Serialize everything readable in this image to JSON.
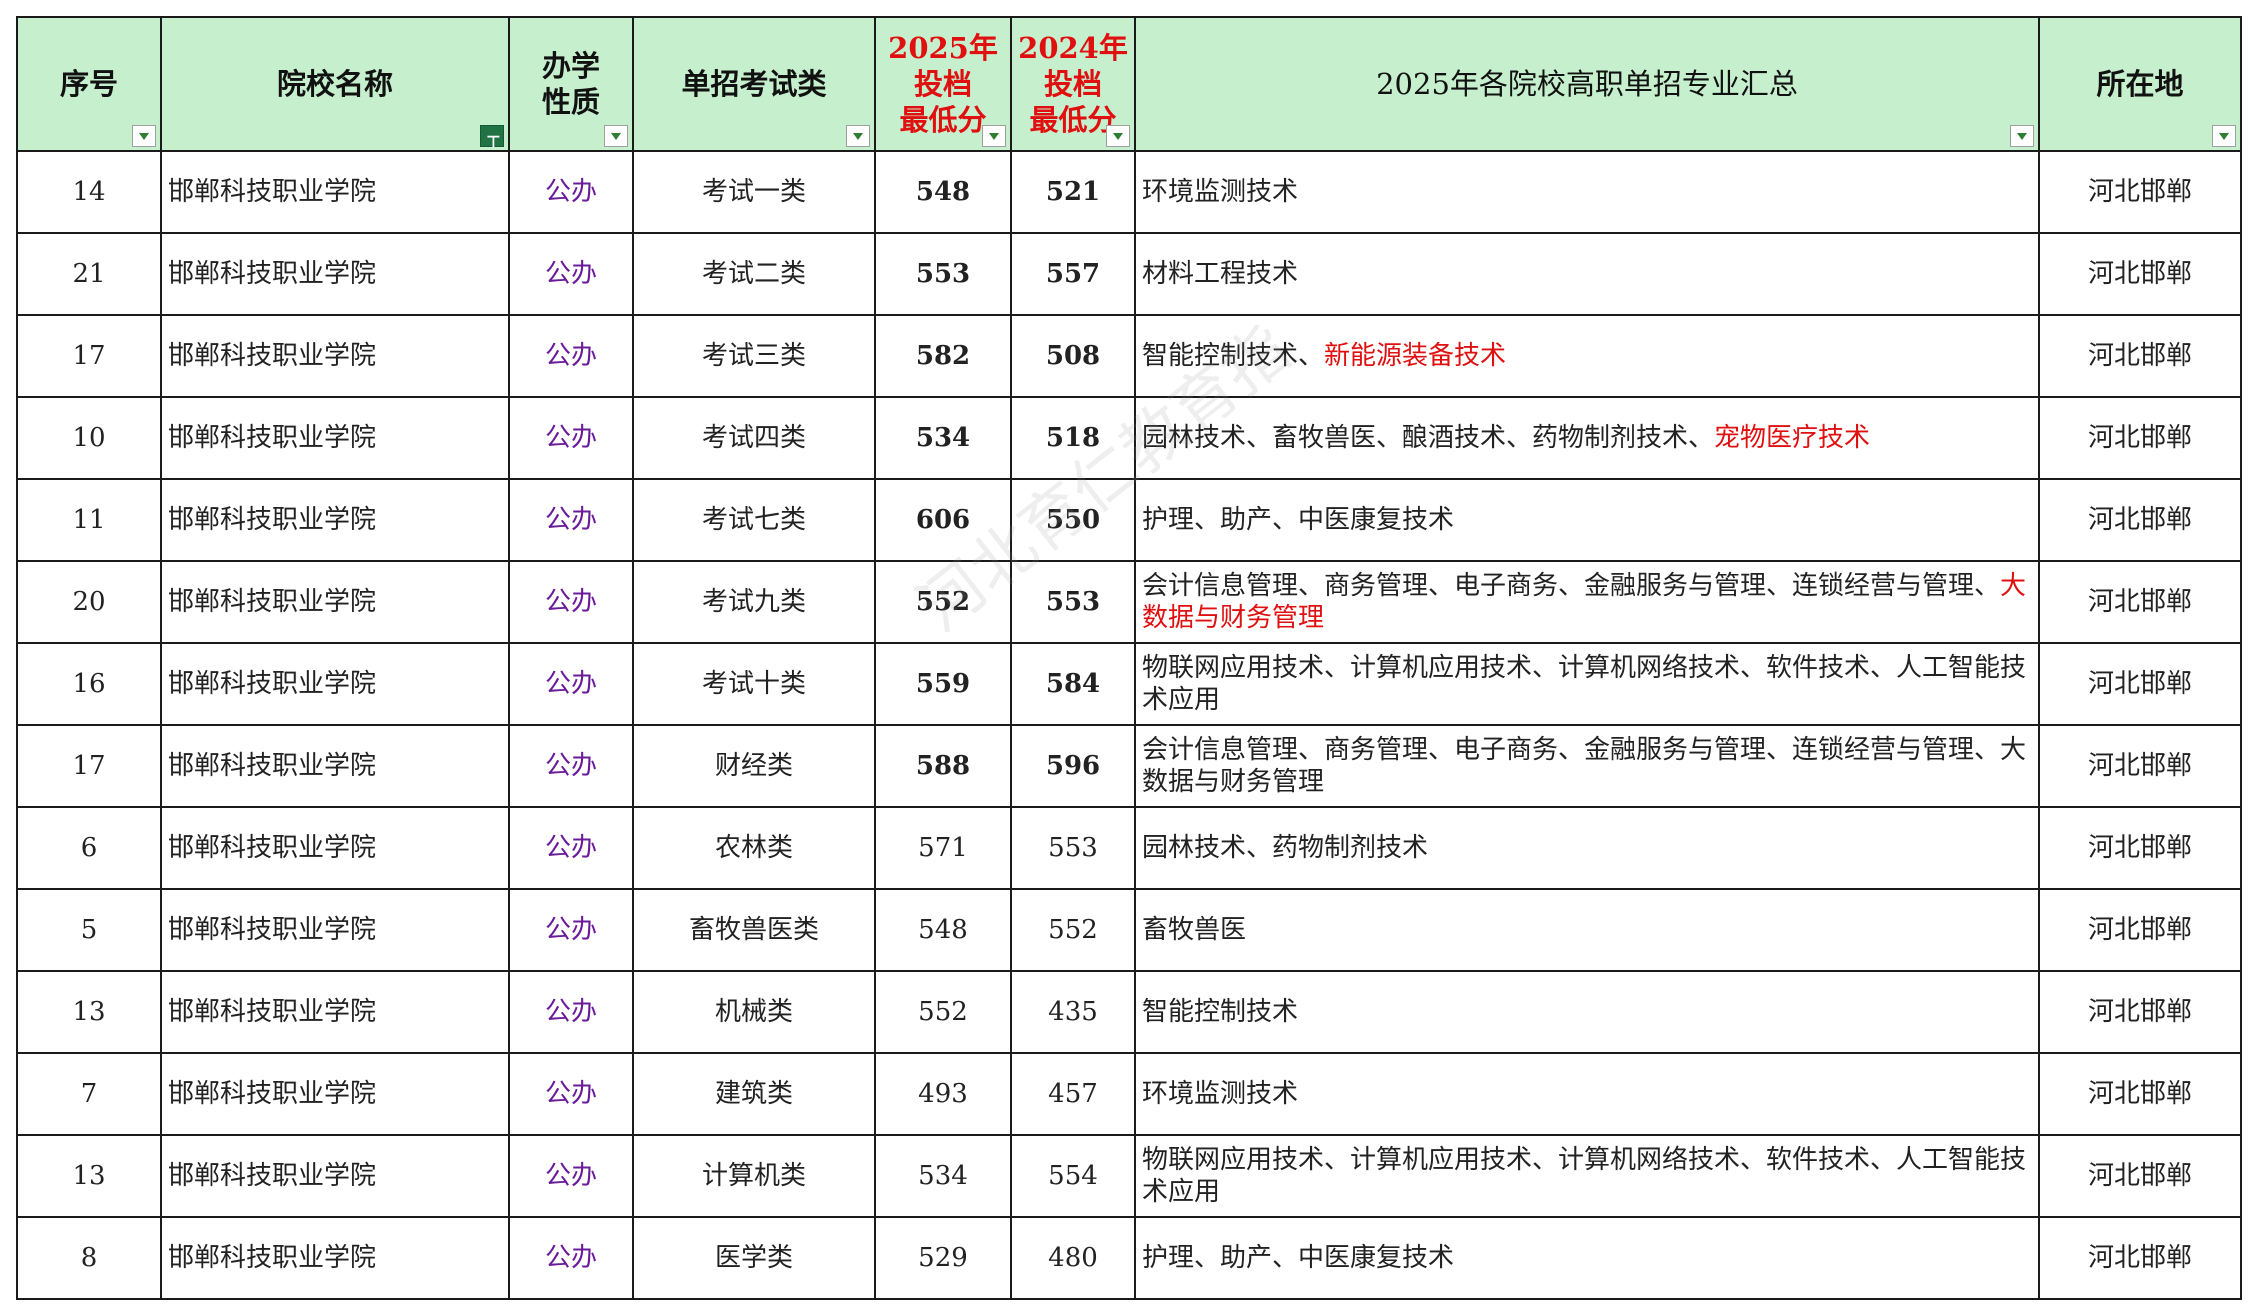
{
  "headers": {
    "seq": "序号",
    "school": "院校名称",
    "nature": [
      "办学",
      "性质"
    ],
    "exam_type": "单招考试类",
    "score_2025": [
      "2025年",
      "投档",
      "最低分"
    ],
    "score_2024": [
      "2024年",
      "投档",
      "最低分"
    ],
    "majors": "2025年各院校高职单招专业汇总",
    "location": "所在地"
  },
  "watermark": "河北育仁教育指",
  "rows": [
    {
      "seq": "14",
      "school": "邯郸科技职业学院",
      "nature": "公办",
      "exam_type": "考试一类",
      "s2025": "548",
      "s2024": "521",
      "majors": "环境监测技术",
      "majors_hl": "",
      "location": "河北邯郸"
    },
    {
      "seq": "21",
      "school": "邯郸科技职业学院",
      "nature": "公办",
      "exam_type": "考试二类",
      "s2025": "553",
      "s2024": "557",
      "majors": "材料工程技术",
      "majors_hl": "",
      "location": "河北邯郸"
    },
    {
      "seq": "17",
      "school": "邯郸科技职业学院",
      "nature": "公办",
      "exam_type": "考试三类",
      "s2025": "582",
      "s2024": "508",
      "majors": "智能控制技术、",
      "majors_hl": "新能源装备技术",
      "location": "河北邯郸"
    },
    {
      "seq": "10",
      "school": "邯郸科技职业学院",
      "nature": "公办",
      "exam_type": "考试四类",
      "s2025": "534",
      "s2024": "518",
      "majors": "园林技术、畜牧兽医、酿酒技术、药物制剂技术、",
      "majors_hl": "宠物医疗技术",
      "location": "河北邯郸"
    },
    {
      "seq": "11",
      "school": "邯郸科技职业学院",
      "nature": "公办",
      "exam_type": "考试七类",
      "s2025": "606",
      "s2024": "550",
      "majors": "护理、助产、中医康复技术",
      "majors_hl": "",
      "location": "河北邯郸"
    },
    {
      "seq": "20",
      "school": "邯郸科技职业学院",
      "nature": "公办",
      "exam_type": "考试九类",
      "s2025": "552",
      "s2024": "553",
      "majors": "会计信息管理、商务管理、电子商务、金融服务与管理、连锁经营与管理、",
      "majors_hl": "大数据与财务管理",
      "location": "河北邯郸"
    },
    {
      "seq": "16",
      "school": "邯郸科技职业学院",
      "nature": "公办",
      "exam_type": "考试十类",
      "s2025": "559",
      "s2024": "584",
      "majors": "物联网应用技术、计算机应用技术、计算机网络技术、软件技术、人工智能技术应用",
      "majors_hl": "",
      "location": "河北邯郸"
    },
    {
      "seq": "17",
      "school": "邯郸科技职业学院",
      "nature": "公办",
      "exam_type": "财经类",
      "s2025": "588",
      "s2024": "596",
      "majors": "会计信息管理、商务管理、电子商务、金融服务与管理、连锁经营与管理、大数据与财务管理",
      "majors_hl": "",
      "location": "河北邯郸"
    },
    {
      "seq": "6",
      "school": "邯郸科技职业学院",
      "nature": "公办",
      "exam_type": "农林类",
      "s2025": "571",
      "s2024": "553",
      "majors": "园林技术、药物制剂技术",
      "majors_hl": "",
      "location": "河北邯郸"
    },
    {
      "seq": "5",
      "school": "邯郸科技职业学院",
      "nature": "公办",
      "exam_type": "畜牧兽医类",
      "s2025": "548",
      "s2024": "552",
      "majors": "畜牧兽医",
      "majors_hl": "",
      "location": "河北邯郸"
    },
    {
      "seq": "13",
      "school": "邯郸科技职业学院",
      "nature": "公办",
      "exam_type": "机械类",
      "s2025": "552",
      "s2024": "435",
      "majors": "智能控制技术",
      "majors_hl": "",
      "location": "河北邯郸"
    },
    {
      "seq": "7",
      "school": "邯郸科技职业学院",
      "nature": "公办",
      "exam_type": "建筑类",
      "s2025": "493",
      "s2024": "457",
      "majors": "环境监测技术",
      "majors_hl": "",
      "location": "河北邯郸"
    },
    {
      "seq": "13",
      "school": "邯郸科技职业学院",
      "nature": "公办",
      "exam_type": "计算机类",
      "s2025": "534",
      "s2024": "554",
      "majors": "物联网应用技术、计算机应用技术、计算机网络技术、软件技术、人工智能技术应用",
      "majors_hl": "",
      "location": "河北邯郸"
    },
    {
      "seq": "8",
      "school": "邯郸科技职业学院",
      "nature": "公办",
      "exam_type": "医学类",
      "s2025": "529",
      "s2024": "480",
      "majors": "护理、助产、中医康复技术",
      "majors_hl": "",
      "location": "河北邯郸"
    }
  ],
  "bold_score_rows": 8,
  "colors": {
    "header_bg": "#c6efce",
    "highlight": "#e01010",
    "nature_text": "#6a1b9a",
    "filter_active": "#217346"
  }
}
